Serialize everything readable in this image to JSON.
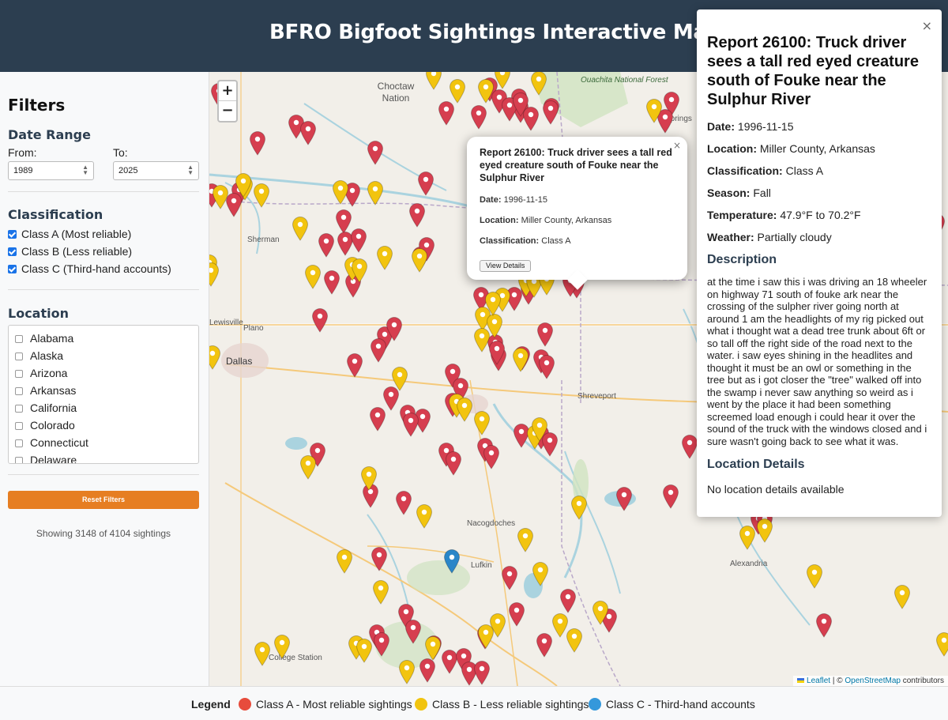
{
  "header": {
    "title": "BFRO Bigfoot Sightings Interactive Map"
  },
  "sidebar": {
    "title": "Filters",
    "date_range": {
      "heading": "Date Range",
      "from_label": "From:",
      "to_label": "To:",
      "from_value": "1989",
      "to_value": "2025"
    },
    "classification": {
      "heading": "Classification",
      "options": [
        {
          "label": "Class A (Most reliable)",
          "checked": true
        },
        {
          "label": "Class B (Less reliable)",
          "checked": true
        },
        {
          "label": "Class C (Third-hand accounts)",
          "checked": true
        }
      ]
    },
    "location": {
      "heading": "Location",
      "states": [
        "Alabama",
        "Alaska",
        "Arizona",
        "Arkansas",
        "California",
        "Colorado",
        "Connecticut",
        "Delaware"
      ]
    },
    "reset_label": "Reset Filters",
    "count_text": "Showing 3148 of 4104 sightings"
  },
  "map": {
    "zoom_in": "+",
    "zoom_out": "−",
    "labels": {
      "ouachita": "Ouachita National Forest",
      "choctaw": "Choctaw Nation",
      "sherman": "Sherman",
      "plano": "Plano",
      "lewisville": "Lewisville",
      "dallas": "Dallas",
      "shreveport": "Shreveport",
      "nacogdoches": "Nacogdoches",
      "lufkin": "Lufkin",
      "alexandria": "Alexandria",
      "college_station": "College Station",
      "hot_springs": "Springs"
    },
    "attribution": {
      "leaflet": "Leaflet",
      "sep": " | © ",
      "osm": "OpenStreetMap",
      "suffix": " contributors"
    },
    "marker_colors": {
      "A": "#d63e4f",
      "B": "#f2c40f",
      "C": "#2a86c8"
    }
  },
  "popup": {
    "close": "×",
    "title": "Report 26100: Truck driver sees a tall red eyed creature south of Fouke near the Sulphur River",
    "date_label": "Date:",
    "date": "1996-11-15",
    "location_label": "Location:",
    "location": "Miller County, Arkansas",
    "class_label": "Classification:",
    "class": "Class A",
    "button": "View Details"
  },
  "panel": {
    "close": "×",
    "title": "Report 26100: Truck driver sees a tall red eyed creature south of Fouke near the Sulphur River",
    "date_label": "Date:",
    "date": "1996-11-15",
    "location_label": "Location:",
    "location": "Miller County, Arkansas",
    "class_label": "Classification:",
    "class": "Class A",
    "season_label": "Season:",
    "season": "Fall",
    "temp_label": "Temperature:",
    "temperature": "47.9°F to 70.2°F",
    "weather_label": "Weather:",
    "weather": "Partially cloudy",
    "desc_heading": "Description",
    "description": "at the time i saw this i was driving an 18 wheeler on highway 71 south of fouke ark near the crossing of the sulpher river going north at around 1 am the headlights of my rig picked out what i thought wat a dead tree trunk about 6ft or so tall off the right side of the road next to the water. i saw eyes shining in the headlites and thought it must be an owl or something in the tree but as i got closer the \"tree\" walked off into the swamp i never saw anything so weird as i went by the place it had been something screemed load enough i could hear it over the sound of the truck with the windows closed and i sure wasn't going back to see what it was.",
    "loc_heading": "Location Details",
    "loc_details": "No location details available"
  },
  "legend": {
    "title": "Legend",
    "items": [
      {
        "label": "Class A - Most reliable sightings",
        "color": "#e74c3c"
      },
      {
        "label": "Class B - Less reliable sightings",
        "color": "#f1c40f"
      },
      {
        "label": "Class C - Third-hand accounts",
        "color": "#3498db"
      }
    ]
  }
}
